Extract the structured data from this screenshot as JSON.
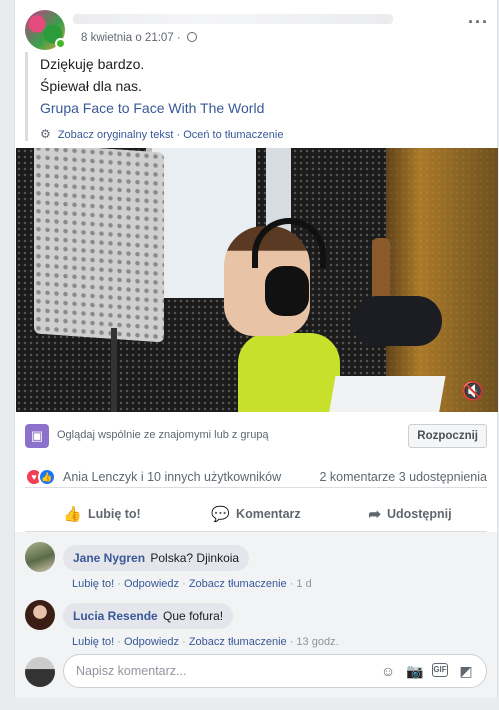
{
  "post": {
    "time": "8 kwietnia o 21:07",
    "text_lines": [
      "Dziękuję bardzo.",
      "Śpiewał dla nas."
    ],
    "group_link": "Grupa Face to Face With The World",
    "see_original": "Zobacz oryginalny tekst",
    "rate_translation": "Oceń to tłumaczenie",
    "more_icon": "more-options-icon"
  },
  "watch_party": {
    "text": "Oglądaj wspólnie ze znajomymi lub z grupą",
    "button": "Rozpocznij"
  },
  "reactions": {
    "names": "Ania Lenczyk i 10 innych użytkowników",
    "comments_count": "2 komentarze",
    "shares_count": "3 udostępnienia"
  },
  "actions": {
    "like": "Lubię to!",
    "comment": "Komentarz",
    "share": "Udostępnij"
  },
  "comments": [
    {
      "author": "Jane Nygren",
      "text": "Polska? Djinkoia",
      "like": "Lubię to!",
      "reply": "Odpowiedz",
      "see_translation": "Zobacz tłumaczenie",
      "time": "1 d"
    },
    {
      "author": "Lucia Resende",
      "text": "Que fofura!",
      "like": "Lubię to!",
      "reply": "Odpowiedz",
      "see_translation": "Zobacz tłumaczenie",
      "time": "13 godz."
    }
  ],
  "composer": {
    "placeholder": "Napisz komentarz..."
  },
  "colors": {
    "link": "#385898",
    "love": "#f33e58",
    "like": "#1877f2",
    "online": "#42b72a"
  }
}
